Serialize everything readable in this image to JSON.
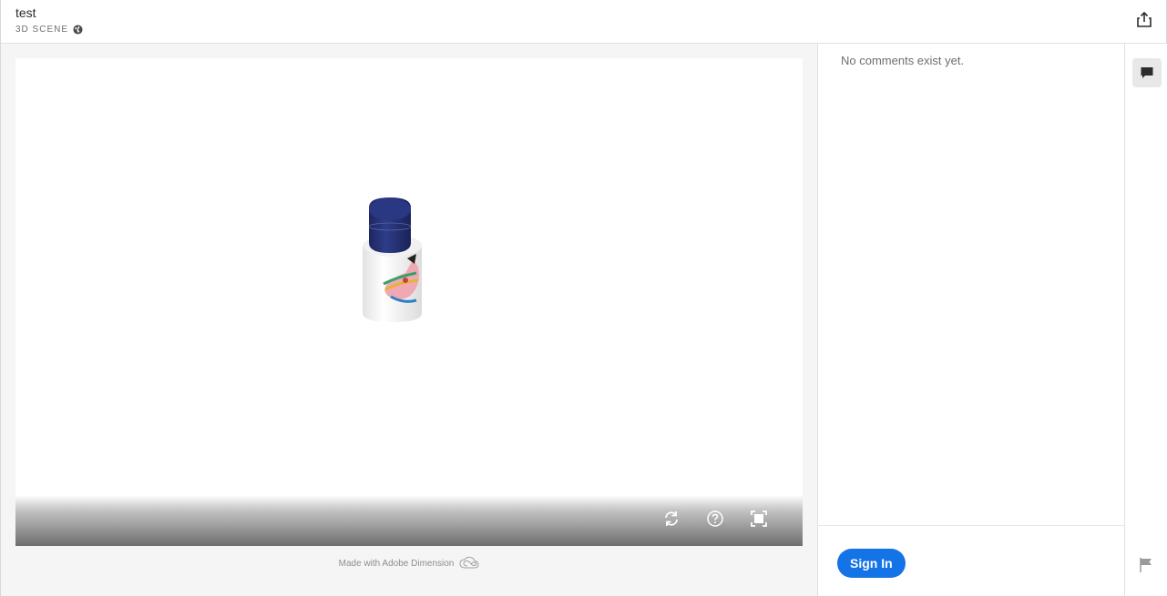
{
  "header": {
    "title": "test",
    "subtitle": "3D SCENE",
    "visibility_icon": "globe-icon",
    "share_icon": "share-icon"
  },
  "viewer": {
    "toolbar": {
      "reset_icon": "refresh-icon",
      "help_icon": "help-icon",
      "fullscreen_icon": "fullscreen-icon"
    },
    "footer_text": "Made with Adobe Dimension",
    "footer_logo": "creative-cloud-logo"
  },
  "comments": {
    "empty_message": "No comments exist yet.",
    "sign_in_label": "Sign In"
  },
  "rail": {
    "comments_icon": "comment-icon",
    "report_icon": "flag-icon"
  },
  "colors": {
    "accent": "#1473e6",
    "cap": "#243273",
    "bottle": "#f4f4f4"
  }
}
